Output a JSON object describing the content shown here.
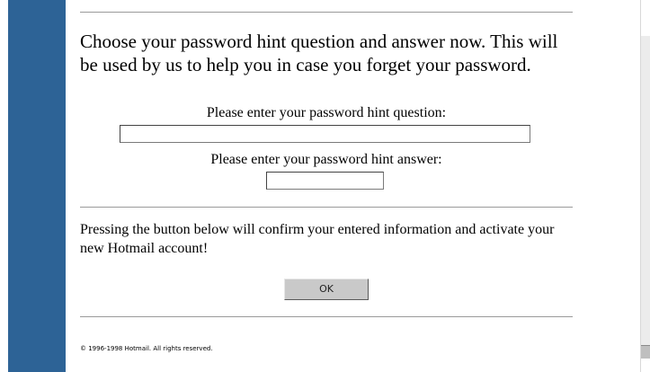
{
  "intro_text": "Choose your password hint question and answer now. This will be used by us to help you in case you forget your password.",
  "hint_question": {
    "label": "Please enter your password hint question:",
    "value": ""
  },
  "hint_answer": {
    "label": "Please enter your password hint answer:",
    "value": ""
  },
  "confirm_text": "Pressing the button below will confirm your entered information and activate your new Hotmail account!",
  "ok_button_label": "OK",
  "copyright": "© 1996-1998 Hotmail. All rights reserved.",
  "colors": {
    "sidebar": "#2d6396",
    "button": "#c9c9c9",
    "rule": "#9a9a9a"
  }
}
